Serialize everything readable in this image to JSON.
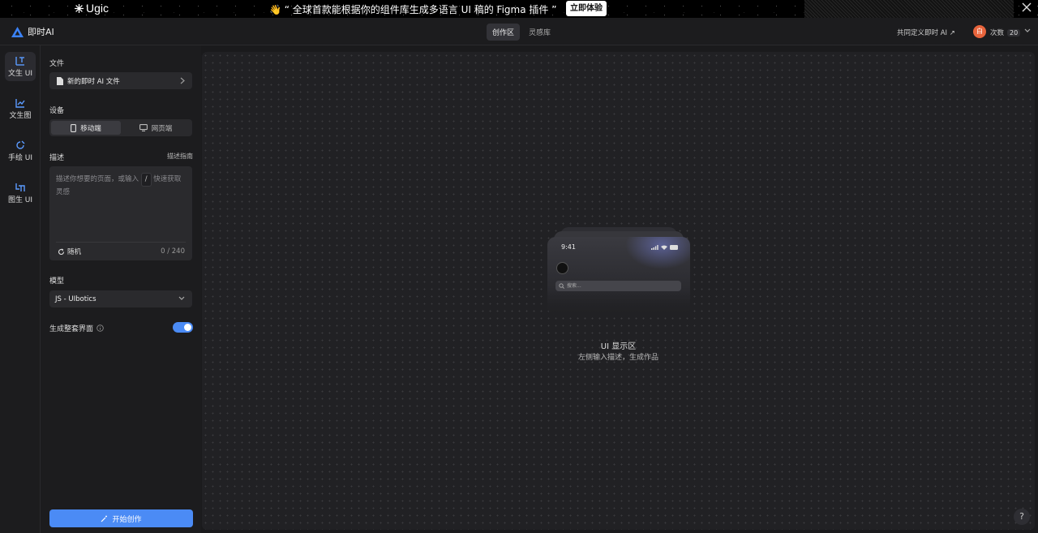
{
  "banner": {
    "logo": "Ugic",
    "message": "👋 “ 全球首款能根据你的组件库生成多语言 UI 稿的 Figma 插件 ”",
    "cta": "立即体验"
  },
  "header": {
    "brand": "即时AI",
    "tabs": [
      "创作区",
      "灵感库"
    ],
    "cocreate_link": "共同定义即时 AI ↗",
    "avatar_initial": "白",
    "times_label": "次数",
    "times_count": "20"
  },
  "nav": {
    "items": [
      {
        "label": "文生 UI",
        "icon": "text-to-ui-icon"
      },
      {
        "label": "文生图",
        "icon": "chart-icon"
      },
      {
        "label": "手绘 UI",
        "icon": "sketch-icon"
      },
      {
        "label": "图生 UI",
        "icon": "image-to-ui-icon"
      }
    ]
  },
  "panel": {
    "file_label": "文件",
    "file_name": "新的即时 AI 文件",
    "device_label": "设备",
    "device_options": [
      "移动端",
      "网页端"
    ],
    "desc_label": "描述",
    "desc_guide": "描述指南",
    "desc_placeholder_a": "描述你想要的页面，或输入",
    "desc_key": "/",
    "desc_placeholder_b": "快速获取灵感",
    "random_label": "随机",
    "char_count": "0 / 240",
    "model_label": "模型",
    "model_value": "JS - UIbotics",
    "full_screens_label": "生成整套界面",
    "full_screens_enabled": true,
    "start_button": "开始创作"
  },
  "canvas": {
    "phone_time": "9:41",
    "phone_search_placeholder": "搜索...",
    "title": "UI 显示区",
    "subtitle": "左侧输入描述，生成作品"
  },
  "help": "?",
  "colors": {
    "accent": "#4b8bf5",
    "avatar": "#e8643c",
    "brand": "#3b82f6"
  }
}
